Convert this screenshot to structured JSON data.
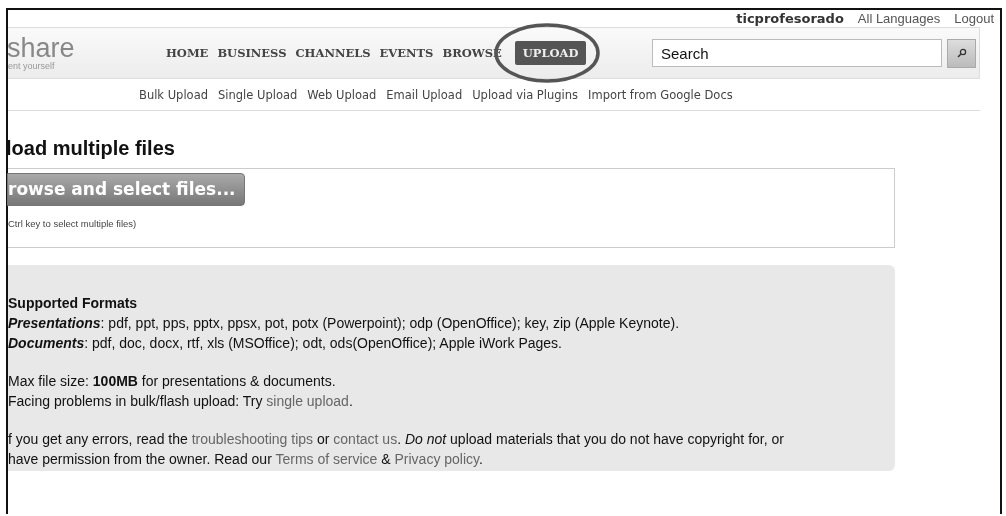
{
  "user_bar": {
    "username": "ticprofesorado",
    "links": [
      "All Languages",
      "Logout"
    ]
  },
  "logo": {
    "name": "share",
    "tagline": "ent yourself"
  },
  "nav": [
    {
      "label": "HOME",
      "selected": false
    },
    {
      "label": "BUSINESS",
      "selected": false
    },
    {
      "label": "CHANNELS",
      "selected": false
    },
    {
      "label": "EVENTS",
      "selected": false
    },
    {
      "label": "BROWSE",
      "selected": false
    },
    {
      "label": "UPLOAD",
      "selected": true
    }
  ],
  "search": {
    "placeholder": "Search"
  },
  "subnav": [
    "Bulk Upload",
    "Single Upload",
    "Web Upload",
    "Email Upload",
    "Upload via Plugins",
    "Import from Google Docs"
  ],
  "heading": "load multiple files",
  "browse_button": "rowse and select files...",
  "hint": "Ctrl key to select multiple files)",
  "formats": {
    "groups": [
      [
        {
          "parts": [
            {
              "kind": "bold",
              "text": "Supported Formats"
            }
          ]
        },
        {
          "parts": [
            {
              "kind": "bolditalic",
              "text": "Presentations"
            },
            {
              "kind": "text",
              "text": ": pdf, ppt, pps, pptx, ppsx, pot, potx (Powerpoint); odp (OpenOffice); key, zip (Apple Keynote)."
            }
          ]
        },
        {
          "parts": [
            {
              "kind": "bolditalic",
              "text": "Documents"
            },
            {
              "kind": "text",
              "text": ": pdf, doc, docx, rtf, xls (MSOffice); odt, ods(OpenOffice); Apple iWork Pages."
            }
          ]
        }
      ],
      [
        {
          "parts": [
            {
              "kind": "text",
              "text": "Max file size: "
            },
            {
              "kind": "bold",
              "text": "100MB"
            },
            {
              "kind": "text",
              "text": " for presentations & documents."
            }
          ]
        },
        {
          "parts": [
            {
              "kind": "text",
              "text": "Facing problems in bulk/flash upload: Try "
            },
            {
              "kind": "link",
              "text": "single upload"
            },
            {
              "kind": "text",
              "text": "."
            }
          ]
        }
      ],
      [
        {
          "parts": [
            {
              "kind": "text",
              "text": "f you get any errors, read the "
            },
            {
              "kind": "link",
              "text": "troubleshooting tips"
            },
            {
              "kind": "text",
              "text": " or "
            },
            {
              "kind": "link",
              "text": "contact us"
            },
            {
              "kind": "text",
              "text": ". "
            },
            {
              "kind": "italic",
              "text": "Do not"
            },
            {
              "kind": "text",
              "text": " upload materials that you do not have copyright for, or have permission from the owner. Read our "
            },
            {
              "kind": "link",
              "text": "Terms of service"
            },
            {
              "kind": "text",
              "text": " & "
            },
            {
              "kind": "link",
              "text": "Privacy policy"
            },
            {
              "kind": "text",
              "text": "."
            }
          ]
        }
      ]
    ]
  }
}
